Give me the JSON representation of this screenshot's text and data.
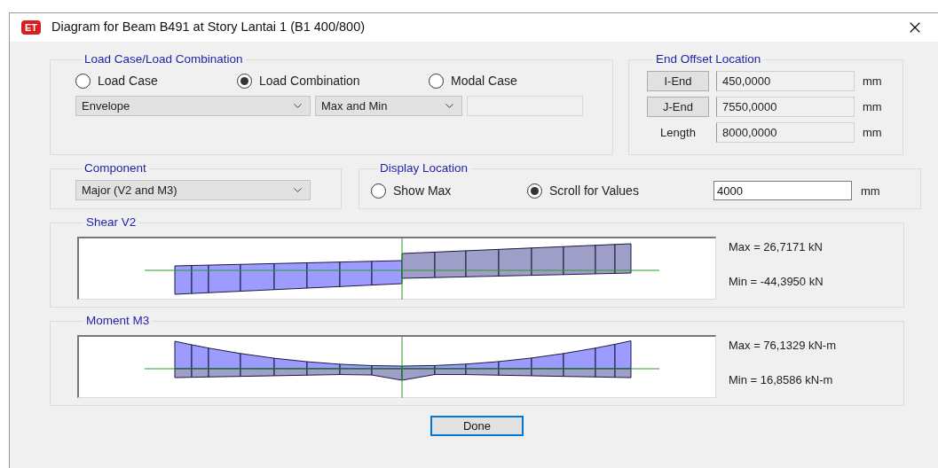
{
  "window": {
    "icon_text": "ET",
    "title": "Diagram for Beam B491 at Story Lantai 1 (B1 400/800)"
  },
  "load_case": {
    "title": "Load Case/Load Combination",
    "options": [
      {
        "label": "Load Case",
        "selected": false
      },
      {
        "label": "Load Combination",
        "selected": true
      },
      {
        "label": "Modal Case",
        "selected": false
      }
    ],
    "combo": "Envelope",
    "mode": "Max and Min"
  },
  "end_offset": {
    "title": "End Offset Location",
    "rows": [
      {
        "kind": "button",
        "label": "I-End",
        "value": "450,0000",
        "unit": "mm"
      },
      {
        "kind": "button",
        "label": "J-End",
        "value": "7550,0000",
        "unit": "mm"
      },
      {
        "kind": "label",
        "label": "Length",
        "value": "8000,0000",
        "unit": "mm"
      }
    ]
  },
  "component": {
    "title": "Component",
    "value": "Major (V2 and M3)"
  },
  "display_location": {
    "title": "Display Location",
    "options": [
      {
        "label": "Show Max",
        "selected": false
      },
      {
        "label": "Scroll for Values",
        "selected": true
      }
    ],
    "value": "4000",
    "unit": "mm"
  },
  "diagrams": [
    {
      "kind": "shear",
      "title": "Shear V2",
      "max": "Max = 26,7171 kN",
      "min": "Min = -44,3950 kN"
    },
    {
      "kind": "moment",
      "title": "Moment M3",
      "max": "Max = 76,1329 kN-m",
      "min": "Min = 16,8586 kN-m"
    }
  ],
  "done_button": "Done"
}
